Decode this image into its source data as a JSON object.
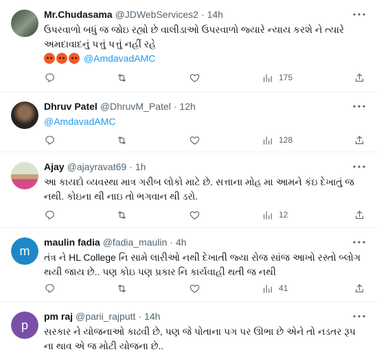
{
  "tweets": [
    {
      "name": "Mr.Chudasama",
      "handle": "@JDWebServices2",
      "time": "14h",
      "text": "ઉપરવાળો બધું જ જોઇ રહ્યો છે વાલીડાઓ ઉપરવાળો જ્યારે ન્યાય કરશે ને ત્યારે અમદાવાદનું પત્તું પત્તું નહીં રહે",
      "emojis": [
        "angry-face",
        "angry-face",
        "angry-face"
      ],
      "mention": "@AmdavadAMC",
      "views": "175",
      "avatar": {
        "kind": "photo",
        "colors": [
          "#3b4a3a",
          "#7a8d76"
        ]
      }
    },
    {
      "name": "Dhruv Patel",
      "handle": "@DhruvM_Patel",
      "time": "12h",
      "text": "",
      "mention": "@AmdavadAMC",
      "views": "128",
      "avatar": {
        "kind": "photo",
        "colors": [
          "#2a2420",
          "#6a5644"
        ]
      }
    },
    {
      "name": "Ajay",
      "handle": "@ajayravat69",
      "time": "1h",
      "text": "આ કાયદો વ્યવસ્થા માત્ર ગરીબ લોકો માટે છે. સત્તાના મોહ મા આમને કંઇ દેખાતું જ નથી. કોઇના થી નાઇ તો ભગવાન થી ડરો.",
      "mention": "",
      "views": "12",
      "avatar": {
        "kind": "photo",
        "colors": [
          "#c6d8c0",
          "#d64a8a"
        ]
      }
    },
    {
      "name": "maulin fadia",
      "handle": "@fadia_maulin",
      "time": "4h",
      "text": "તંત્ર ને HL College નિ સામે લારીઓ નથી દેખાતી જ્યા રોજ સાંજ આખો રસ્તો બ્લોગ થયી જાય છે.. પણ કોઇ પણ પ્રકાર નિ કાર્યવાહી થતી જ નથી",
      "mention": "",
      "views": "41",
      "avatar": {
        "kind": "initial",
        "letter": "m",
        "color": "#1e88c8"
      }
    },
    {
      "name": "pm raj",
      "handle": "@parii_rajputt",
      "time": "14h",
      "text": "સરકાર ને યોજનાઓ કાઢવી છે, પણ જે પોતાના પગ પર ઊભા છે એને તો નડતર રૂપ ના થાવ એ જ મોટી યોજના છે..",
      "mention": "",
      "views": "",
      "avatar": {
        "kind": "initial",
        "letter": "p",
        "color": "#7b4fa8"
      }
    }
  ]
}
